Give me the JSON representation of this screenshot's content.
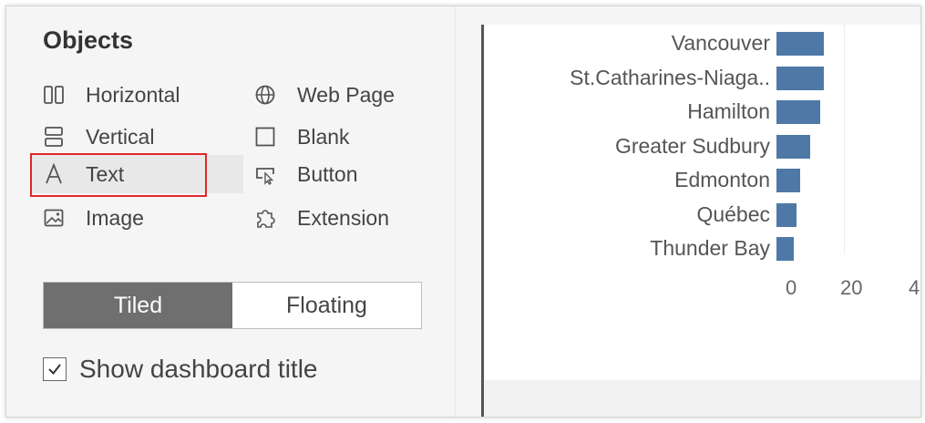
{
  "objects_panel": {
    "title": "Objects",
    "items": [
      {
        "label": "Horizontal",
        "icon": "horizontal-layout-icon"
      },
      {
        "label": "Web Page",
        "icon": "globe-icon"
      },
      {
        "label": "Vertical",
        "icon": "vertical-layout-icon"
      },
      {
        "label": "Blank",
        "icon": "blank-square-icon"
      },
      {
        "label": "Text",
        "icon": "text-a-icon"
      },
      {
        "label": "Button",
        "icon": "button-cursor-icon"
      },
      {
        "label": "Image",
        "icon": "image-icon"
      },
      {
        "label": "Extension",
        "icon": "puzzle-icon"
      }
    ]
  },
  "layout_toggle": {
    "tiled": "Tiled",
    "floating": "Floating",
    "selected": "Tiled"
  },
  "show_title": {
    "label": "Show dashboard title",
    "checked": true
  },
  "colors": {
    "bar": "#4e79a7",
    "highlight": "#e0262b",
    "toggle_active": "#6f6f6f"
  },
  "chart_data": {
    "type": "bar",
    "orientation": "horizontal",
    "categories": [
      "Vancouver",
      "St.Catharines-Niaga..",
      "Hamilton",
      "Greater Sudbury",
      "Edmonton",
      "Québec",
      "Thunder Bay"
    ],
    "values": [
      14,
      14,
      13,
      10,
      7,
      6,
      5
    ],
    "x_ticks": [
      "0",
      "20",
      "4"
    ]
  }
}
